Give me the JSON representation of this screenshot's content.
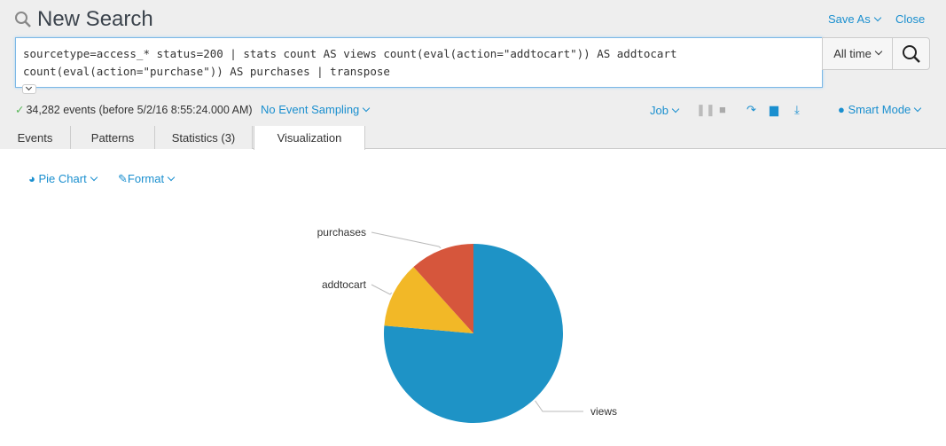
{
  "header": {
    "title": "New Search",
    "save_as": "Save As",
    "close": "Close"
  },
  "search": {
    "query_line1": "sourcetype=access_* status=200 | stats count AS views count(eval(action=\"addtocart\")) AS addtocart",
    "query_line2": "count(eval(action=\"purchase\")) AS purchases | transpose",
    "time_range": "All time"
  },
  "status": {
    "events": "34,282 events (before 5/2/16 8:55:24.000 AM)",
    "sampling": "No Event Sampling",
    "job": "Job",
    "mode": "Smart Mode"
  },
  "tabs": [
    {
      "label": "Events"
    },
    {
      "label": "Patterns"
    },
    {
      "label": "Statistics (3)"
    },
    {
      "label": "Visualization",
      "active": true
    }
  ],
  "viz": {
    "type_label": "Pie Chart",
    "format_label": "Format"
  },
  "chart_data": {
    "type": "pie",
    "categories": [
      "views",
      "addtocart",
      "purchases"
    ],
    "values": [
      34282,
      5360,
      5236
    ],
    "colors": [
      "#1e93c6",
      "#f2b827",
      "#d6563c"
    ],
    "start": "top",
    "direction": "clockwise"
  }
}
